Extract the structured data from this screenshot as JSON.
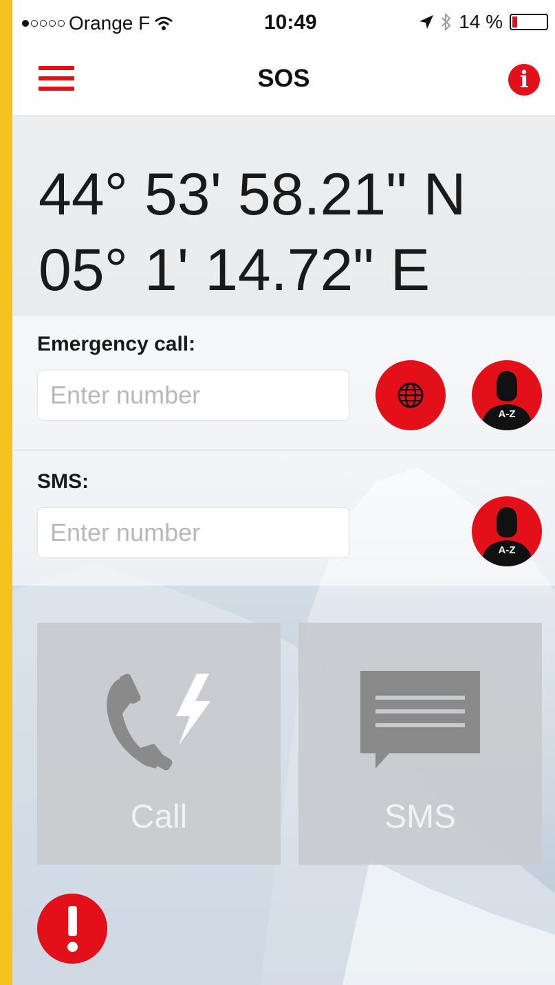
{
  "status_bar": {
    "carrier": "Orange F",
    "signal_bars_filled": 1,
    "signal_bars_total": 5,
    "wifi_icon": "wifi-icon",
    "time": "10:49",
    "location_icon": "location-arrow-icon",
    "bluetooth_icon": "bluetooth-icon",
    "battery_percent": "14 %",
    "battery_level": 0.14
  },
  "nav": {
    "title": "SOS",
    "menu_icon": "hamburger-menu-icon",
    "info_icon": "info-icon"
  },
  "coordinates": {
    "latitude": "44° 53' 58.21\" N",
    "longitude": "05° 1' 14.72\" E"
  },
  "emergency_call": {
    "label": "Emergency call:",
    "placeholder": "Enter number",
    "value": "",
    "globe_icon": "globe-icon",
    "contacts_icon": "contacts-az-icon",
    "contacts_badge": "A-Z"
  },
  "sms": {
    "label": "SMS:",
    "placeholder": "Enter number",
    "value": "",
    "contacts_icon": "contacts-az-icon",
    "contacts_badge": "A-Z"
  },
  "actions": {
    "call_label": "Call",
    "call_icon": "emergency-phone-icon",
    "sms_label": "SMS",
    "sms_icon": "message-bubble-icon"
  },
  "alert_icon": "exclamation-icon",
  "colors": {
    "accent": "#e3101a",
    "button_gray": "#c8cbce",
    "icon_gray": "#8a8a8a",
    "frame": "#f6c21f"
  }
}
